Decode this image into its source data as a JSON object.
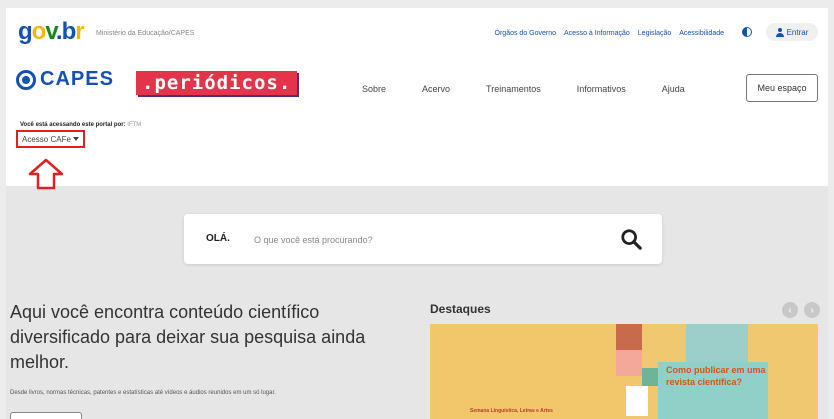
{
  "govbr": {
    "logo": "gov.br",
    "ministry": "Ministério da Educação/CAPES",
    "links": [
      "Órgãos do Governo",
      "Acesso à Informação",
      "Legislação",
      "Acessibilidade"
    ],
    "login_label": "Entrar"
  },
  "header": {
    "capes_logo": "CAPES",
    "periodicos_logo": ".periódicos.",
    "nav": [
      "Sobre",
      "Acervo",
      "Treinamentos",
      "Informativos",
      "Ajuda"
    ],
    "meu_espaco": "Meu espaço"
  },
  "access": {
    "label": "Você está acessando este portal por:",
    "institution": "IFTM",
    "cafe_button": "Acesso CAFe"
  },
  "search": {
    "greeting": "OLÁ.",
    "placeholder": "O que você está procurando?"
  },
  "hero": {
    "headline": "Aqui você encontra conteúdo científico diversificado para deixar sua pesquisa ainda melhor.",
    "subtext": "Desde livros, normas técnicas, patentes e estatísticas até vídeos e áudios reunidos em um só lugar."
  },
  "destaques": {
    "title": "Destaques",
    "banner_headline": "Como publicar em uma revista científica?",
    "banner_footer": "Semana Linguística, Letras e Artes"
  },
  "colors": {
    "brand_blue": "#1351b4",
    "highlight_red": "#e02020",
    "periodicos_red": "#e3344a"
  }
}
